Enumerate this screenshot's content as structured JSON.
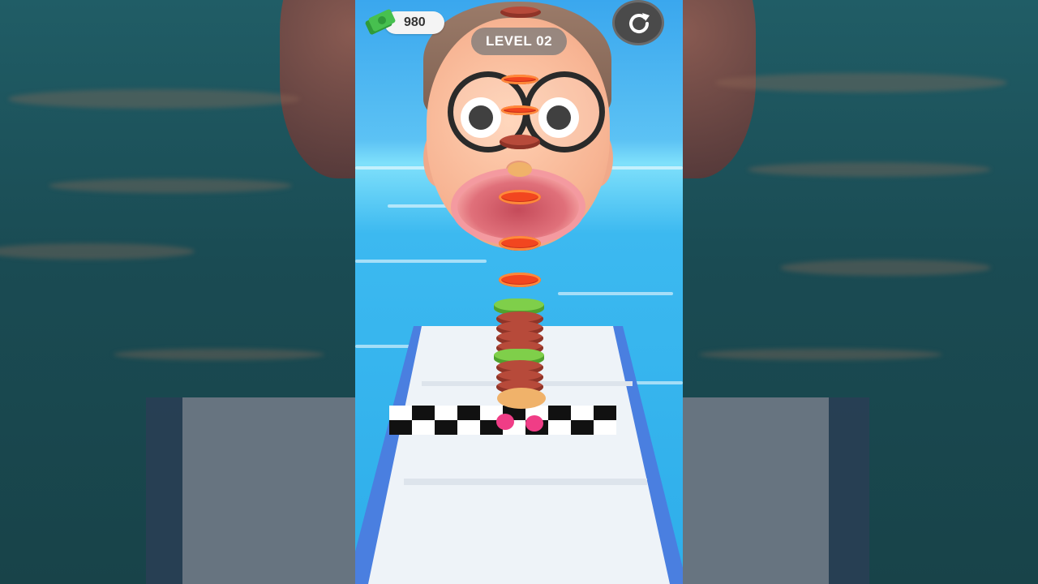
{
  "hud": {
    "money": "980",
    "level": "LEVEL 02"
  },
  "icons": {
    "money": "cash-stack-icon",
    "restart": "restart-icon"
  },
  "colors": {
    "accent_pink": "#f03d86",
    "water": "#3cb9f0",
    "track": "#eef3f8"
  }
}
